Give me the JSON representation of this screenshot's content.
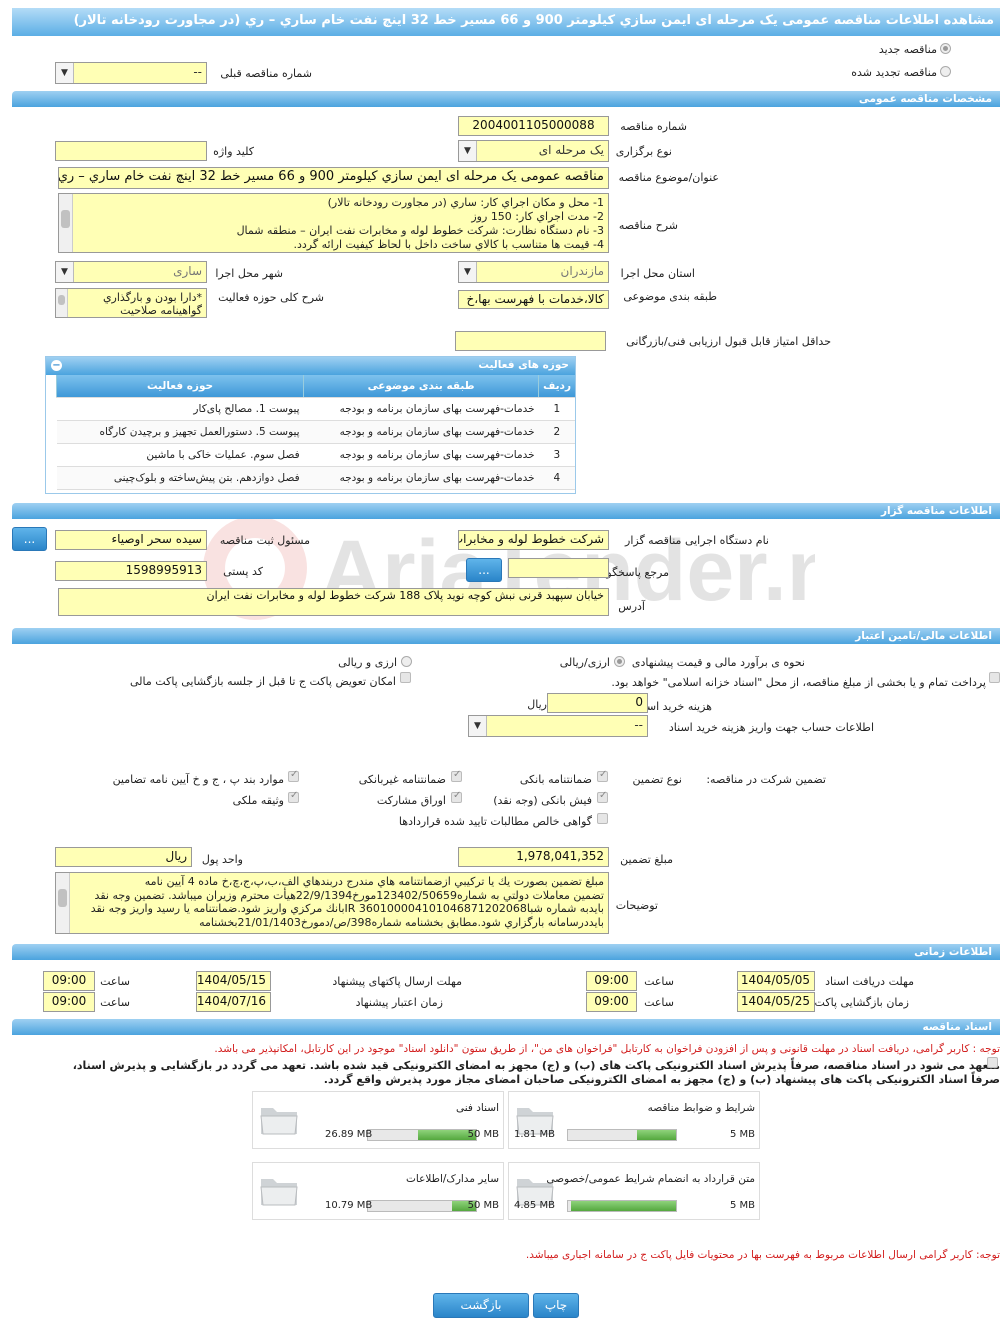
{
  "page_title": "مشاهده اطلاعات مناقصه عمومی یک مرحله ای ایمن سازي کیلومتر 900 و 66 مسیر خط 32 اینچ نفت خام ساري – ري (در مجاورت رودخانه تالار)",
  "top": {
    "new_tender": "مناقصه جدید",
    "renewed_tender": "مناقصه تجدید شده",
    "prev_number_label": "شماره مناقصه قبلی",
    "prev_number_value": "--"
  },
  "sections": {
    "general": "مشخصات مناقصه عمومی",
    "organizer": "اطلاعات مناقصه گزار",
    "financial": "اطلاعات مالی/تامین اعتبار",
    "timing": "اطلاعات زمانی",
    "documents": "اسناد مناقصه"
  },
  "general": {
    "tender_number_label": "شماره مناقصه",
    "tender_number": "2004001105000088",
    "keyword_label": "کلید واژه",
    "keyword": "",
    "hold_type_label": "نوع برگزاری",
    "hold_type": "یک مرحله ای",
    "subject_label": "عنوان/موضوع مناقصه",
    "subject": "مناقصه عمومی یک مرحله ای ایمن سازي کیلومتر 900 و 66 مسیر خط 32 اینچ نفت خام ساري – ري",
    "desc_label": "شرح مناقصه",
    "desc_lines": [
      "1-     محل و مکان اجراي کار: ساري (در مجاورت رودخانه تالار)",
      "2-     مدت اجراي کار: 150 روز",
      "3-     نام دستگاه نظارت: شرکت خطوط لوله و مخابرات نفت ایران – منطقه شمال",
      "4-     قیمت ها متناسب با کالاي ساخت داخل با لحاظ کیفیت ارائه گردد."
    ],
    "province_label": "استان محل اجرا",
    "province": "مازندران",
    "city_label": "شهر محل اجرا",
    "city": "ساری",
    "category_label": "طبقه بندی موضوعی",
    "category": "کالا،خدمات با فهرست بها،خ",
    "activity_label": "شرح کلی حوزه فعالیت",
    "activity_lines": [
      "*دارا بودن و بارگذاري",
      "گواهینامه صلاحیت"
    ],
    "min_score_label": "حداقل امتیاز قابل قبول ارزیابی فنی/بازرگانی",
    "min_score": ""
  },
  "activity_table": {
    "title": "حوزه های فعالیت",
    "headers": [
      "ردیف",
      "طبقه بندی موضوعی",
      "حوزه فعالیت"
    ],
    "rows": [
      {
        "n": "1",
        "cat": "خدمات-فهرست بهای سازمان برنامه و بودجه",
        "field": "پیوست 1. مصالح پای‌کار"
      },
      {
        "n": "2",
        "cat": "خدمات-فهرست بهای سازمان برنامه و بودجه",
        "field": "پیوست 5. دستورالعمل تجهیز و برچیدن کارگاه"
      },
      {
        "n": "3",
        "cat": "خدمات-فهرست بهای سازمان برنامه و بودجه",
        "field": "فصل سوم. عملیات خاکی با ماشین"
      },
      {
        "n": "4",
        "cat": "خدمات-فهرست بهای سازمان برنامه و بودجه",
        "field": "فصل دوازدهم. بتن پیش‌ساخته و بلوک‌چینی"
      }
    ]
  },
  "organizer": {
    "org_label": "نام دستگاه اجرایی مناقصه گزار",
    "org": "شرکت خطوط لوله و مخابرات",
    "registrar_label": "مسئول ثبت مناقصه",
    "registrar": "سیده سحر اوصیاء",
    "more": "...",
    "ref_label": "مرجع پاسخگویی",
    "ref": "",
    "postal_label": "کد پستی",
    "postal": "1598995913",
    "address_label": "آدرس",
    "address": "خیابان سپهبد قرنی نبش کوچه نوید پلاک 188 شرکت خطوط لوله و مخابرات نفت ایران"
  },
  "financial": {
    "estimate_label": "نحوه ی برآورد مالی و قیمت پیشنهادی",
    "opt_currency_rial": "ارزی/ریالی",
    "opt_currency_and_rial": "ارزی و ریالی",
    "full_payment_text": "پرداخت تمام و یا بخشی از مبلغ مناقصه، از محل \"اسناد خزانه اسلامی\" خواهد بود.",
    "swap_text": "امکان تعویض پاکت ج تا قبل از جلسه بازگشایی پاکت مالی",
    "doc_fee_label": "هزینه خرید اسناد",
    "doc_fee": "0",
    "rial": "ریال",
    "account_label": "اطلاعات حساب جهت واریز هزینه خرید اسناد",
    "account": "--",
    "guarantee_label": "تضمین شرکت در مناقصه:",
    "guarantee_type_label": "نوع تضمین",
    "g_bank": "ضمانتنامه بانکی",
    "g_nonbank": "ضمانتنامه غیربانکی",
    "g_items": "موارد بند پ ، ج و خ آیین نامه تضامین",
    "g_cash": "فیش بانکی (وجه نقد)",
    "g_bonds": "اوراق مشارکت",
    "g_property": "وثیقه ملکی",
    "g_claims": "گواهی خالص مطالبات تایید شده قراردادها",
    "amount_label": "مبلغ تضمین",
    "amount": "1,978,041,352",
    "unit_label": "واحد پول",
    "unit": "ریال",
    "notes_label": "توضیحات",
    "notes_lines": [
      "مبلغ تضمین بصورت یك یا تركیبي ازضمانتنامه هاي مندرج دربندهاي الف،ب،پ،ج،چ،خ ماده 4 آیین نامه",
      "تضمین معاملات دولتي به شماره123402/50659مورخ22/9/1394هیأت محترم وزیران میباشد. تضمین وجه نقد",
      "بایدبه شماره شباIR 360100004101046871202068بانك مركزي واریز شود.ضمانتنامه یا رسید واریز وجه نقد",
      "بایددرسامانه بارگزاري شود.مطابق بخشنامه شماره398/ص/دمورخ21/01/1403بخشنامه"
    ]
  },
  "timing": {
    "receive_label": "مهلت دریافت اسناد",
    "receive_date": "1404/05/05",
    "send_label": "مهلت ارسال پاکتهای پیشنهاد",
    "send_date": "1404/05/15",
    "open_label": "زمان بازگشایی پاکت ها",
    "open_date": "1404/05/25",
    "valid_label": "زمان اعتبار پیشنهاد",
    "valid_date": "1404/07/16",
    "time_label": "ساعت",
    "t1": "09:00",
    "t2": "09:00",
    "t3": "09:00",
    "t4": "09:00"
  },
  "docs": {
    "note1": "توجه : کاربر گرامی، دریافت اسناد در مهلت قانونی و پس از افزودن فراخوان به کارتابل \"فراخوان های من\"، از طریق ستون \"دانلود اسناد\" موجود در این کارتابل، امکانپذیر می باشد.",
    "commit1": "متعهد می شود در اسناد مناقصه، صرفاً پذیرش اسناد الکترونیکی پاکت های (ب) و (ج) مجهز به امضای الکترونیکی قید شده باشد. تعهد می گردد در بازگشایی و پذیرش اسناد،",
    "commit2": "صرفاً اسناد الکترونیکی پاکت های پیشنهاد (ب) و (ج) مجهز به امضای الکترونیکی صاحبان امضای مجاز مورد پذیرش واقع گردد.",
    "files": [
      {
        "name": "شرایط و ضوابط مناقصه",
        "size": "1.81 MB",
        "max": "5 MB",
        "fill": 0.36
      },
      {
        "name": "اسناد فنی",
        "size": "26.89 MB",
        "max": "50 MB",
        "fill": 0.54
      },
      {
        "name": "متن قرارداد به انضمام شرایط عمومی/خصوصی",
        "size": "4.85 MB",
        "max": "5 MB",
        "fill": 0.97
      },
      {
        "name": "سایر مدارک/اطلاعات",
        "size": "10.79 MB",
        "max": "50 MB",
        "fill": 0.22
      }
    ],
    "note2": "توجه: کاربر گرامی ارسال اطلاعات مربوط به فهرست بها در محتویات فایل پاکت ج در سامانه اجباری میباشد."
  },
  "buttons": {
    "print": "چاپ",
    "back": "بازگشت"
  },
  "watermark": "AriaTender.neT"
}
